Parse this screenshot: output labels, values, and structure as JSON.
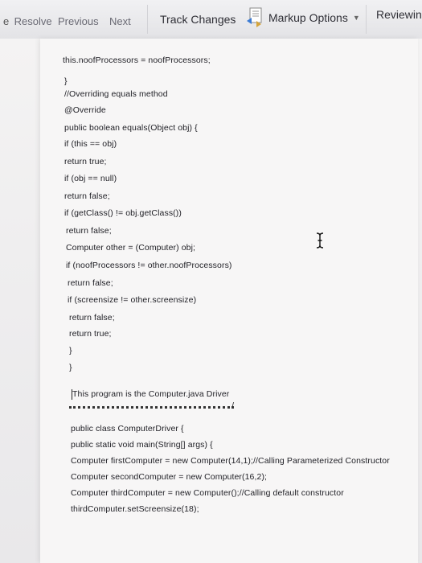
{
  "toolbar": {
    "resolve": "Resolve",
    "previous": "Previous",
    "next": "Next",
    "track_changes": "Track Changes",
    "markup_options": "Markup Options",
    "reviewing": "Reviewing"
  },
  "document": {
    "lines": [
      "this.noofProcessors = noofProcessors;",
      "}",
      "//Overriding equals method",
      "@Override",
      "public boolean equals(Object obj) {",
      "if (this == obj)",
      "return true;",
      "if (obj == null)",
      "return false;",
      "if (getClass() != obj.getClass())",
      "return false;",
      "Computer other = (Computer) obj;",
      "if (noofProcessors != other.noofProcessors)",
      "return false;",
      "if (screensize != other.screensize)",
      "return false;",
      "return true;",
      "}",
      "}",
      "This program is the Computer.java Driver",
      "public class ComputerDriver {",
      "public static void main(String[] args) {",
      "Computer firstComputer = new Computer(14,1);//Calling Parameterized Constructor",
      "Computer secondComputer = new Computer(16,2);",
      "Computer thirdComputer = new Computer();//Calling default constructor",
      "thirdComputer.setScreensize(18);"
    ],
    "comment_end": "/"
  },
  "colors": {
    "toolbar_bg": "#e9e9ec",
    "page_bg": "#f2f1f1",
    "text": "#1e1e24"
  }
}
